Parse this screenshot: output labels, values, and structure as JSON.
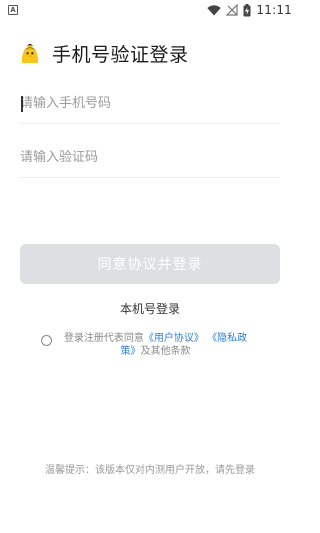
{
  "status_bar": {
    "left_icon": "android-notification-icon",
    "icons": [
      "wifi-icon",
      "no-signal-icon",
      "battery-charging-icon"
    ],
    "time": "11:11"
  },
  "header": {
    "logo_icon": "yellow-chick-logo",
    "title": "手机号验证登录"
  },
  "form": {
    "phone_placeholder": "请输入手机号码",
    "phone_value": "",
    "code_placeholder": "请输入验证码",
    "code_value": ""
  },
  "login_button_label": "同意协议并登录",
  "local_login_label": "本机号登录",
  "agreement": {
    "prefix": "登录注册代表同意",
    "user_agreement": "《用户协议》",
    "privacy_policy": "《隐私政策》",
    "suffix": "及其他条款",
    "checked": false
  },
  "notice": "温馨提示：该版本仅对内测用户开放，请先登录",
  "colors": {
    "link": "#2f7fd6",
    "button_disabled": "#dedfe3",
    "logo_yellow": "#f7c51c"
  }
}
